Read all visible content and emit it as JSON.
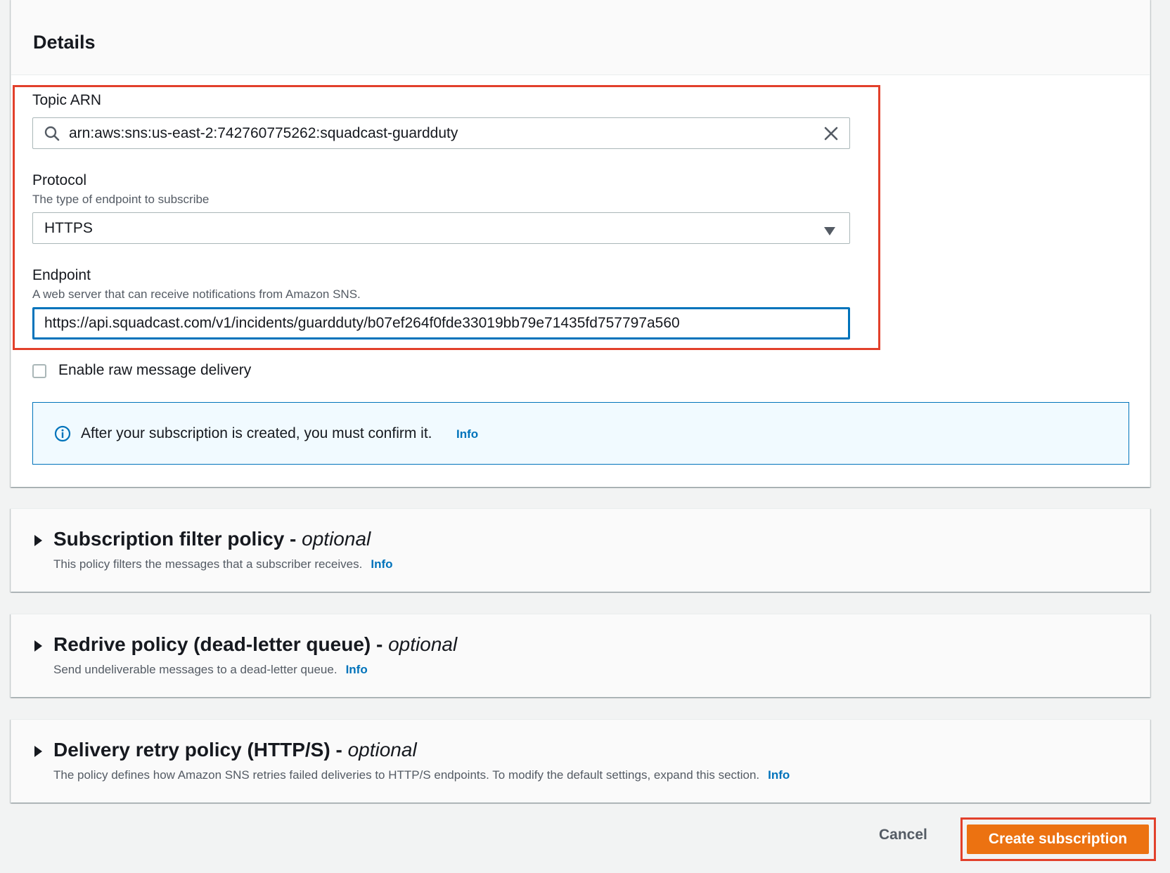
{
  "details": {
    "title": "Details",
    "topic_arn": {
      "label": "Topic ARN",
      "value": "arn:aws:sns:us-east-2:742760775262:squadcast-guardduty"
    },
    "protocol": {
      "label": "Protocol",
      "description": "The type of endpoint to subscribe",
      "selected": "HTTPS"
    },
    "endpoint": {
      "label": "Endpoint",
      "description": "A web server that can receive notifications from Amazon SNS.",
      "value": "https://api.squadcast.com/v1/incidents/guardduty/b07ef264f0fde33019bb79e71435fd757797a560"
    },
    "raw_delivery": {
      "label": "Enable raw message delivery",
      "checked": false
    },
    "alert": {
      "text": "After your subscription is created, you must confirm it.",
      "info": "Info"
    }
  },
  "sections": [
    {
      "title": "Subscription filter policy - ",
      "optional": "optional",
      "description": "This policy filters the messages that a subscriber receives.",
      "info": "Info"
    },
    {
      "title": "Redrive policy (dead-letter queue) - ",
      "optional": "optional",
      "description": "Send undeliverable messages to a dead-letter queue.",
      "info": "Info"
    },
    {
      "title": "Delivery retry policy (HTTP/S) - ",
      "optional": "optional",
      "description": "The policy defines how Amazon SNS retries failed deliveries to HTTP/S endpoints. To modify the default settings, expand this section.",
      "info": "Info"
    }
  ],
  "actions": {
    "cancel": "Cancel",
    "create": "Create subscription"
  },
  "colors": {
    "primary_button": "#ec7211",
    "link": "#0073bb",
    "highlight": "#e2402b"
  }
}
